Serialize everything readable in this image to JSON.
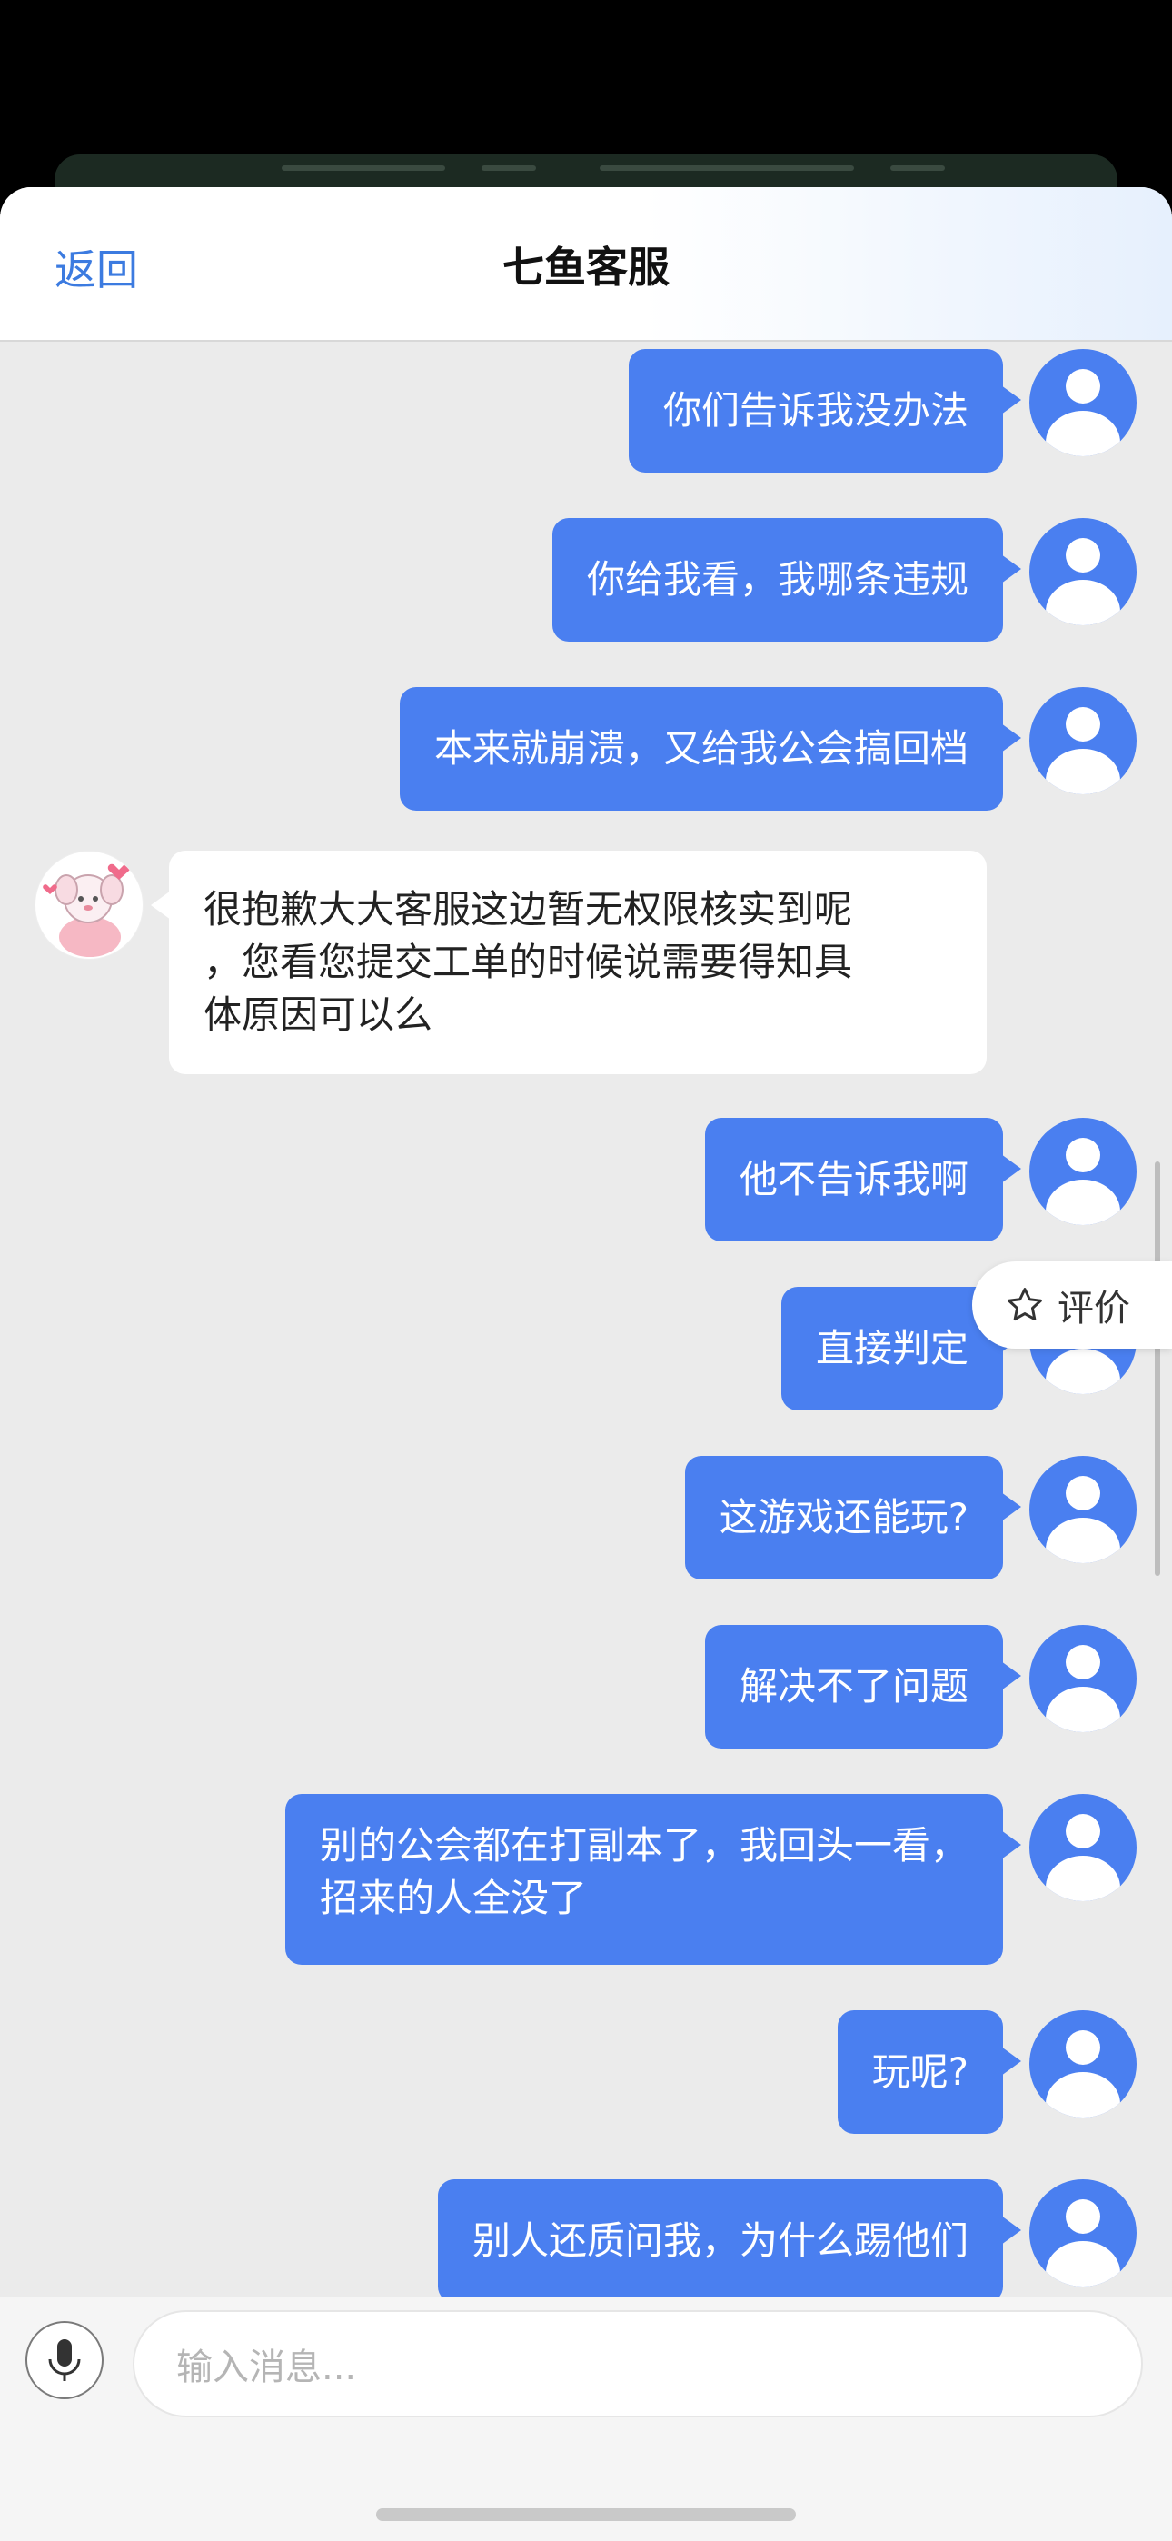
{
  "header": {
    "back_label": "返回",
    "title": "七鱼客服"
  },
  "messages": [
    {
      "from": "user",
      "text": "你们告诉我没办法"
    },
    {
      "from": "user",
      "text": "你给我看，我哪条违规"
    },
    {
      "from": "user",
      "text": "本来就崩溃，又给我公会搞回档"
    },
    {
      "from": "agent",
      "lines": [
        "很抱歉大大客服这边暂无权限核实到呢",
        "，您看您提交工单的时候说需要得知具",
        "体原因可以么"
      ]
    },
    {
      "from": "user",
      "text": "他不告诉我啊"
    },
    {
      "from": "user",
      "text": "直接判定"
    },
    {
      "from": "user",
      "text": "这游戏还能玩?"
    },
    {
      "from": "user",
      "text": "解决不了问题"
    },
    {
      "from": "user",
      "lines": [
        "别的公会都在打副本了，我回头一看，",
        "招来的人全没了"
      ]
    },
    {
      "from": "user",
      "text": "玩呢?"
    },
    {
      "from": "user",
      "text": "别人还质问我，为什么踢他们"
    }
  ],
  "rating": {
    "label": "评价",
    "icon": "star-outline-icon"
  },
  "composer": {
    "placeholder": "输入消息...",
    "mic_icon": "microphone-icon"
  },
  "colors": {
    "user_bubble": "#4a7ff0",
    "accent": "#3c7be0",
    "chat_background": "#ebebeb"
  }
}
